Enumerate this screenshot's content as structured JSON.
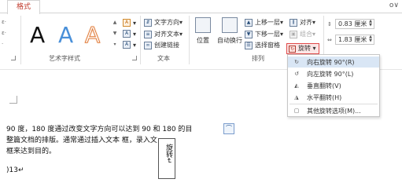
{
  "tabs": {
    "active_tab": "格式",
    "window_ctrl": "ο∨"
  },
  "wordart": {
    "samples": [
      "A",
      "A",
      "A"
    ],
    "group_label": "艺术字样式",
    "side_labels": [
      "…",
      "…"
    ]
  },
  "text_group": {
    "direction": "文字方向",
    "align": "对齐文本",
    "link": "创建链接",
    "label": "文本"
  },
  "arrange_group": {
    "position": "位置",
    "wrap": "自动换行",
    "bring_forward": "上移一层",
    "send_backward": "下移一层",
    "selection_pane": "选择窗格",
    "align": "对齐",
    "group": "组合",
    "rotate": "旋转",
    "label": "排列"
  },
  "size_group": {
    "height": "0.83 厘米",
    "width": "1.83 厘米"
  },
  "rotate_menu": {
    "items": [
      {
        "icon": "rotate-right-icon",
        "glyph": "↻",
        "label": "向右旋转 90°(R)"
      },
      {
        "icon": "rotate-left-icon",
        "glyph": "↺",
        "label": "向左旋转 90°(L)"
      },
      {
        "icon": "flip-vertical-icon",
        "glyph": "◭",
        "label": "垂直翻转(V)"
      },
      {
        "icon": "flip-horizontal-icon",
        "glyph": "◮",
        "label": "水平翻转(H)"
      },
      {
        "icon": "more-rotation-options-icon",
        "glyph": "▢",
        "label": "其他旋转选项(M)..."
      }
    ]
  },
  "document": {
    "line1": "90 度，180 度通过改变文字方向可以达到 90 和 180 的目",
    "line2": "整篇文档的排版。通常通过插入文本                     框，录入文",
    "line3": "框来达到目的。",
    "line4": ")13↵",
    "textbox_text": "旋转↵"
  },
  "colors": {
    "accent": "#c0392b",
    "highlight": "#d9e6f5",
    "rotate_border": "#e04848"
  }
}
